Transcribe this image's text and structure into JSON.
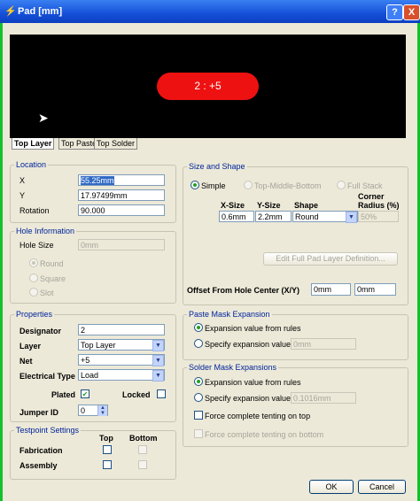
{
  "window": {
    "title": "Pad [mm]",
    "help_btn": "?",
    "close_btn": "X"
  },
  "preview": {
    "pad_label": "2 : +5"
  },
  "tabs": [
    "Top Layer",
    "Top Paste",
    "Top Solder"
  ],
  "location": {
    "title": "Location",
    "x_label": "X",
    "x_value": "55.25mm",
    "y_label": "Y",
    "y_value": "17.97499mm",
    "rotation_label": "Rotation",
    "rotation_value": "90.000"
  },
  "hole": {
    "title": "Hole Information",
    "size_label": "Hole Size",
    "size_value": "0mm",
    "round_label": "Round",
    "square_label": "Square",
    "slot_label": "Slot"
  },
  "properties": {
    "title": "Properties",
    "designator_label": "Designator",
    "designator_value": "2",
    "layer_label": "Layer",
    "layer_value": "Top Layer",
    "net_label": "Net",
    "net_value": "+5",
    "electrical_label": "Electrical Type",
    "electrical_value": "Load",
    "plated_label": "Plated",
    "locked_label": "Locked",
    "jumper_label": "Jumper ID",
    "jumper_value": "0"
  },
  "testpoint": {
    "title": "Testpoint Settings",
    "top_label": "Top",
    "bottom_label": "Bottom",
    "fabrication_label": "Fabrication",
    "assembly_label": "Assembly"
  },
  "size_shape": {
    "title": "Size and Shape",
    "simple_label": "Simple",
    "tmb_label": "Top-Middle-Bottom",
    "full_stack_label": "Full Stack",
    "col_xsize": "X-Size",
    "col_ysize": "Y-Size",
    "col_shape": "Shape",
    "col_corner": "Corner Radius (%)",
    "xsize": "0.6mm",
    "ysize": "2.2mm",
    "shape": "Round",
    "corner": "50%",
    "edit_full_btn": "Edit Full Pad Layer Definition...",
    "offset_label": "Offset From Hole Center (X/Y)",
    "offset_x": "0mm",
    "offset_y": "0mm"
  },
  "paste": {
    "title": "Paste Mask Expansion",
    "from_rules": "Expansion value from rules",
    "specify": "Specify expansion value",
    "specify_value": "0mm"
  },
  "solder": {
    "title": "Solder Mask Expansions",
    "from_rules": "Expansion value from rules",
    "specify": "Specify expansion value",
    "specify_value": "0.1016mm",
    "force_top": "Force complete tenting on top",
    "force_bottom": "Force complete tenting on bottom"
  },
  "buttons": {
    "ok": "OK",
    "cancel": "Cancel"
  },
  "icons": {
    "help": "help-icon",
    "close": "close-icon",
    "cursor": "cursor-icon"
  }
}
